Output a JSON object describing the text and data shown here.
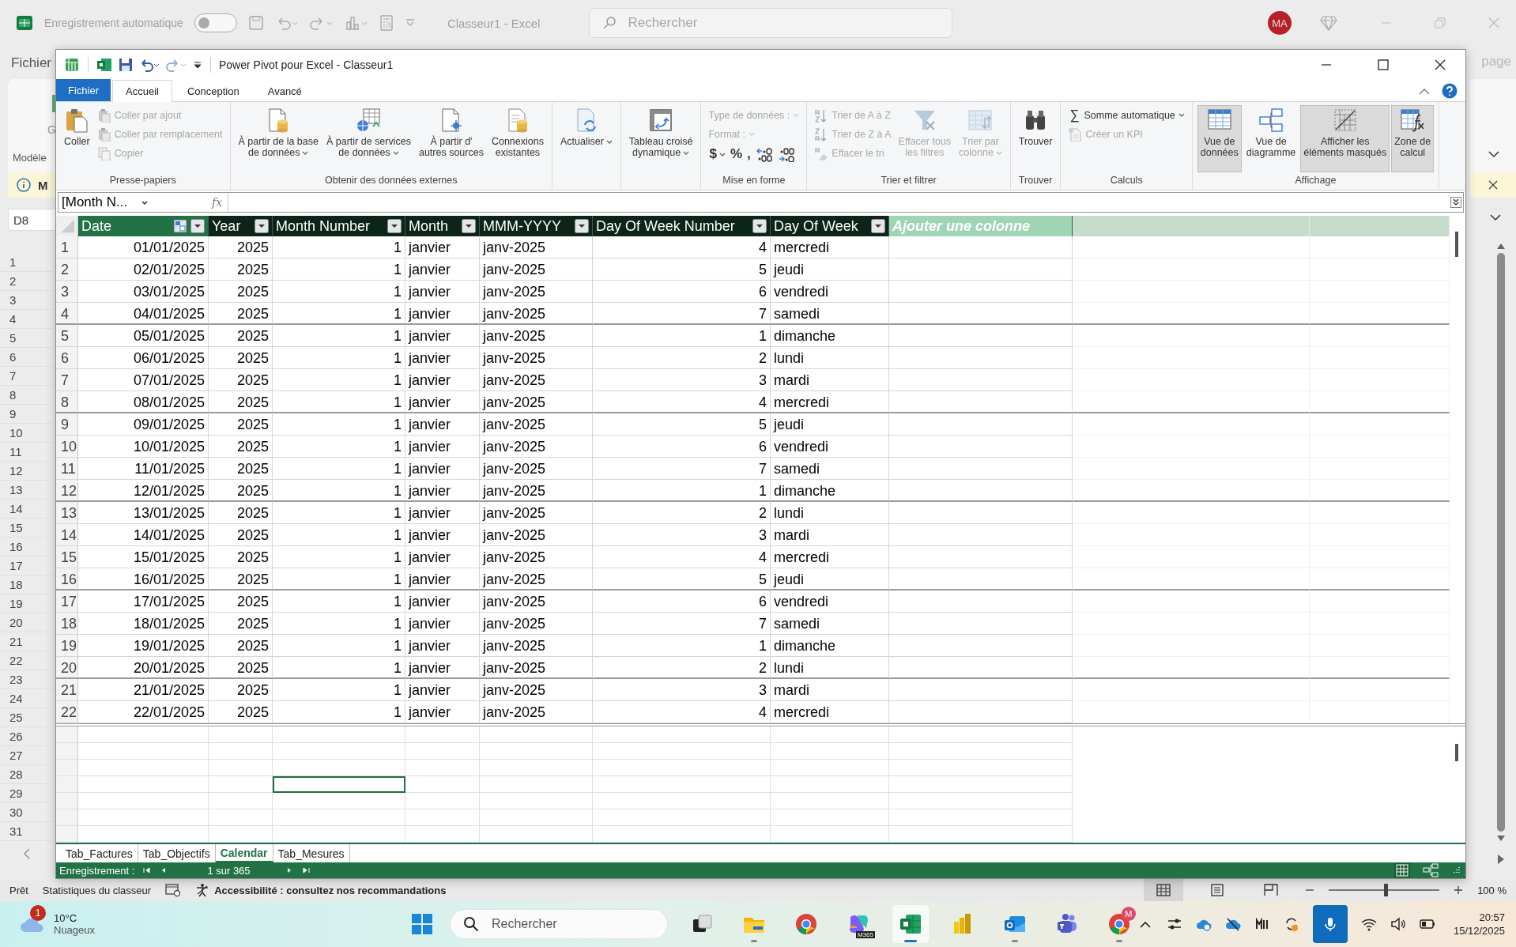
{
  "excel_window": {
    "autosave_label": "Enregistrement automatique",
    "autosave_on": false,
    "title": "Classeur1  -  Excel",
    "search_placeholder": "Rechercher",
    "avatar": "MA",
    "file_tab": "Fichier",
    "ribbon_fragment": "G",
    "group_fragment": "Modèle",
    "message_fragment": "M",
    "name_box": "D8",
    "right_tab_fragment": "page",
    "row_headers": [
      "1",
      "2",
      "3",
      "4",
      "5",
      "6",
      "7",
      "8",
      "9",
      "10",
      "11",
      "12",
      "13",
      "14",
      "15",
      "16",
      "17",
      "18",
      "19",
      "20",
      "21",
      "22",
      "23",
      "24",
      "25",
      "26",
      "27",
      "28",
      "29",
      "30",
      "31"
    ],
    "status_bar": {
      "ready": "Prêt",
      "stats": "Statistiques du classeur",
      "accessibility": "Accessibilité : consultez nos recommandations",
      "views": [
        {
          "selected": true
        },
        {
          "selected": false
        },
        {
          "selected": false
        }
      ],
      "zoom_slider": {
        "level": 0.52
      },
      "zoom": "100 %"
    }
  },
  "power_pivot": {
    "title": "Power Pivot pour Excel - Classeur1",
    "tabs": [
      {
        "label": "Fichier",
        "kind": "file",
        "selected": false
      },
      {
        "label": "Accueil",
        "kind": "tab",
        "selected": true
      },
      {
        "label": "Conception",
        "kind": "tab",
        "selected": false
      },
      {
        "label": "Avancé",
        "kind": "tab",
        "selected": false
      }
    ],
    "ribbon": [
      {
        "label": "Presse-papiers",
        "items": [
          {
            "kind": "large",
            "lines": [
              "Coller"
            ],
            "disabled": false
          },
          {
            "kind": "small",
            "label": "Coller par ajout",
            "disabled": true
          },
          {
            "kind": "small",
            "label": "Coller par remplacement",
            "disabled": true
          },
          {
            "kind": "small",
            "label": "Copier",
            "disabled": true
          }
        ]
      },
      {
        "label": "Obtenir des données externes",
        "items": [
          {
            "kind": "large",
            "lines": [
              "À partir de la base",
              "de données"
            ],
            "dropdown": true,
            "disabled": false
          },
          {
            "kind": "large",
            "lines": [
              "À partir de services",
              "de données"
            ],
            "dropdown": true,
            "disabled": false
          },
          {
            "kind": "large",
            "lines": [
              "À partir d'",
              "autres sources"
            ],
            "disabled": false
          },
          {
            "kind": "large",
            "lines": [
              "Connexions",
              "existantes"
            ],
            "disabled": false
          }
        ]
      },
      {
        "items": [
          {
            "kind": "large",
            "lines": [
              "Actualiser"
            ],
            "dropdown": true,
            "disabled": false
          }
        ]
      },
      {
        "items": [
          {
            "kind": "large",
            "lines": [
              "Tableau croisé",
              "dynamique"
            ],
            "dropdown": true,
            "disabled": false
          }
        ]
      },
      {
        "label": "Mise en forme",
        "items": [
          {
            "kind": "field",
            "label": "Type de données :",
            "disabled": true
          },
          {
            "kind": "field",
            "label": "Format :",
            "disabled": true
          },
          {
            "kind": "format",
            "buttons": [
              {
                "kind": "symbol",
                "symbol": "$",
                "dropdown": true
              },
              {
                "kind": "symbol",
                "symbol": "%"
              },
              {
                "kind": "symbol",
                "symbol": ","
              },
              {
                "kind": "more_decimals"
              },
              {
                "kind": "fewer_decimals"
              }
            ]
          }
        ]
      },
      {
        "label": "Trier et filtrer",
        "items": [
          {
            "kind": "small",
            "label": "Trier de A à Z",
            "disabled": true
          },
          {
            "kind": "small",
            "label": "Trier de Z à A",
            "disabled": true
          },
          {
            "kind": "small",
            "label": "Effacer le tri",
            "disabled": true
          },
          {
            "kind": "large",
            "lines": [
              "Effacer tous",
              "les filtres"
            ],
            "disabled": true
          },
          {
            "kind": "large",
            "lines": [
              "Trier par",
              "colonne"
            ],
            "dropdown": true,
            "disabled": true
          }
        ]
      },
      {
        "label": "Trouver",
        "items": [
          {
            "kind": "large",
            "lines": [
              "Trouver"
            ],
            "disabled": false
          }
        ]
      },
      {
        "label": "Calculs",
        "items": [
          {
            "kind": "small",
            "label": "Somme automatique",
            "symbol": "∑",
            "dropdown": true,
            "disabled": false
          },
          {
            "kind": "small",
            "label": "Créer un KPI",
            "disabled": true
          }
        ]
      },
      {
        "label": "Affichage",
        "items": [
          {
            "kind": "large",
            "lines": [
              "Vue de",
              "données"
            ],
            "selected": true
          },
          {
            "kind": "large",
            "lines": [
              "Vue de",
              "diagramme"
            ],
            "selected": false
          },
          {
            "kind": "large",
            "lines": [
              "Afficher les",
              "éléments masqués"
            ],
            "selected": true
          },
          {
            "kind": "large",
            "lines": [
              "Zone de",
              "calcul"
            ],
            "selected": true
          }
        ]
      }
    ],
    "formula_bar": {
      "name": "[Month N...",
      "function_symbol": "fx"
    },
    "table": {
      "columns": [
        {
          "label": "Date",
          "kind": "date_key"
        },
        {
          "label": "Year",
          "kind": "data"
        },
        {
          "label": "Month Number",
          "kind": "data"
        },
        {
          "label": "Month",
          "kind": "data"
        },
        {
          "label": "MMM-YYYY",
          "kind": "data"
        },
        {
          "label": "Day Of Week Number",
          "kind": "data"
        },
        {
          "label": "Day Of Week",
          "kind": "data"
        },
        {
          "label": "Ajouter une colonne",
          "kind": "add"
        }
      ],
      "rows": [
        {
          "number": "1",
          "cells": [
            "01/01/2025",
            "2025",
            "1",
            "janvier",
            "janv-2025",
            "4",
            "mercredi"
          ]
        },
        {
          "number": "2",
          "cells": [
            "02/01/2025",
            "2025",
            "1",
            "janvier",
            "janv-2025",
            "5",
            "jeudi"
          ]
        },
        {
          "number": "3",
          "cells": [
            "03/01/2025",
            "2025",
            "1",
            "janvier",
            "janv-2025",
            "6",
            "vendredi"
          ]
        },
        {
          "number": "4",
          "cells": [
            "04/01/2025",
            "2025",
            "1",
            "janvier",
            "janv-2025",
            "7",
            "samedi"
          ]
        },
        {
          "number": "5",
          "cells": [
            "05/01/2025",
            "2025",
            "1",
            "janvier",
            "janv-2025",
            "1",
            "dimanche"
          ]
        },
        {
          "number": "6",
          "cells": [
            "06/01/2025",
            "2025",
            "1",
            "janvier",
            "janv-2025",
            "2",
            "lundi"
          ]
        },
        {
          "number": "7",
          "cells": [
            "07/01/2025",
            "2025",
            "1",
            "janvier",
            "janv-2025",
            "3",
            "mardi"
          ]
        },
        {
          "number": "8",
          "cells": [
            "08/01/2025",
            "2025",
            "1",
            "janvier",
            "janv-2025",
            "4",
            "mercredi"
          ]
        },
        {
          "number": "9",
          "cells": [
            "09/01/2025",
            "2025",
            "1",
            "janvier",
            "janv-2025",
            "5",
            "jeudi"
          ]
        },
        {
          "number": "10",
          "cells": [
            "10/01/2025",
            "2025",
            "1",
            "janvier",
            "janv-2025",
            "6",
            "vendredi"
          ]
        },
        {
          "number": "11",
          "cells": [
            "11/01/2025",
            "2025",
            "1",
            "janvier",
            "janv-2025",
            "7",
            "samedi"
          ]
        },
        {
          "number": "12",
          "cells": [
            "12/01/2025",
            "2025",
            "1",
            "janvier",
            "janv-2025",
            "1",
            "dimanche"
          ]
        },
        {
          "number": "13",
          "cells": [
            "13/01/2025",
            "2025",
            "1",
            "janvier",
            "janv-2025",
            "2",
            "lundi"
          ]
        },
        {
          "number": "14",
          "cells": [
            "14/01/2025",
            "2025",
            "1",
            "janvier",
            "janv-2025",
            "3",
            "mardi"
          ]
        },
        {
          "number": "15",
          "cells": [
            "15/01/2025",
            "2025",
            "1",
            "janvier",
            "janv-2025",
            "4",
            "mercredi"
          ]
        },
        {
          "number": "16",
          "cells": [
            "16/01/2025",
            "2025",
            "1",
            "janvier",
            "janv-2025",
            "5",
            "jeudi"
          ]
        },
        {
          "number": "17",
          "cells": [
            "17/01/2025",
            "2025",
            "1",
            "janvier",
            "janv-2025",
            "6",
            "vendredi"
          ]
        },
        {
          "number": "18",
          "cells": [
            "18/01/2025",
            "2025",
            "1",
            "janvier",
            "janv-2025",
            "7",
            "samedi"
          ]
        },
        {
          "number": "19",
          "cells": [
            "19/01/2025",
            "2025",
            "1",
            "janvier",
            "janv-2025",
            "1",
            "dimanche"
          ]
        },
        {
          "number": "20",
          "cells": [
            "20/01/2025",
            "2025",
            "1",
            "janvier",
            "janv-2025",
            "2",
            "lundi"
          ]
        },
        {
          "number": "21",
          "cells": [
            "21/01/2025",
            "2025",
            "1",
            "janvier",
            "janv-2025",
            "3",
            "mardi"
          ]
        },
        {
          "number": "22",
          "cells": [
            "22/01/2025",
            "2025",
            "1",
            "janvier",
            "janv-2025",
            "4",
            "mercredi"
          ]
        }
      ]
    },
    "calc_area": {
      "rows": [
        [
          {
            "selected": false
          },
          {
            "selected": false
          },
          {
            "selected": false
          },
          {
            "selected": false
          },
          {
            "selected": false
          },
          {
            "selected": false
          },
          {
            "selected": false
          },
          {
            "selected": false
          }
        ],
        [
          {
            "selected": false
          },
          {
            "selected": false
          },
          {
            "selected": false
          },
          {
            "selected": false
          },
          {
            "selected": false
          },
          {
            "selected": false
          },
          {
            "selected": false
          },
          {
            "selected": false
          }
        ],
        [
          {
            "selected": false
          },
          {
            "selected": false
          },
          {
            "selected": false
          },
          {
            "selected": false
          },
          {
            "selected": false
          },
          {
            "selected": false
          },
          {
            "selected": false
          },
          {
            "selected": false
          }
        ],
        [
          {
            "selected": false
          },
          {
            "selected": false
          },
          {
            "selected": true
          },
          {
            "selected": false
          },
          {
            "selected": false
          },
          {
            "selected": false
          },
          {
            "selected": false
          },
          {
            "selected": false
          }
        ],
        [
          {
            "selected": false
          },
          {
            "selected": false
          },
          {
            "selected": false
          },
          {
            "selected": false
          },
          {
            "selected": false
          },
          {
            "selected": false
          },
          {
            "selected": false
          },
          {
            "selected": false
          }
        ],
        [
          {
            "selected": false
          },
          {
            "selected": false
          },
          {
            "selected": false
          },
          {
            "selected": false
          },
          {
            "selected": false
          },
          {
            "selected": false
          },
          {
            "selected": false
          },
          {
            "selected": false
          }
        ],
        [
          {
            "selected": false
          },
          {
            "selected": false
          },
          {
            "selected": false
          },
          {
            "selected": false
          },
          {
            "selected": false
          },
          {
            "selected": false
          },
          {
            "selected": false
          },
          {
            "selected": false
          }
        ]
      ]
    },
    "sheet_tabs": [
      {
        "label": "Tab_Factures",
        "selected": false
      },
      {
        "label": "Tab_Objectifs",
        "selected": false
      },
      {
        "label": "Calendar",
        "selected": true
      },
      {
        "label": "Tab_Mesures",
        "selected": false
      }
    ],
    "record_bar": {
      "label": "Enregistrement :",
      "position": "1 sur 365"
    }
  },
  "taskbar": {
    "weather": {
      "badge": "1",
      "temperature": "10°C",
      "condition": "Nuageux"
    },
    "search_placeholder": "Rechercher",
    "apps": [
      {
        "kind": "task_view",
        "selected": false,
        "running": false
      },
      {
        "kind": "explorer",
        "selected": false,
        "running": true
      },
      {
        "kind": "chrome",
        "selected": false,
        "running": false
      },
      {
        "kind": "copilot",
        "label": "M365",
        "selected": false,
        "running": false
      },
      {
        "kind": "excel",
        "selected": true,
        "running": true
      },
      {
        "kind": "powerbi",
        "selected": false,
        "running": false
      },
      {
        "kind": "outlook",
        "selected": false,
        "running": true
      },
      {
        "kind": "teams",
        "selected": false,
        "running": false
      },
      {
        "kind": "chrome",
        "badge": "M",
        "selected": false,
        "running": true
      }
    ],
    "tray": [
      {
        "kind": "chevron",
        "active": false
      },
      {
        "kind": "sliders",
        "active": false
      },
      {
        "kind": "cloud_sync",
        "active": false
      },
      {
        "kind": "cloud_off",
        "active": false
      },
      {
        "kind": "bars",
        "active": false
      },
      {
        "kind": "sync",
        "active": false
      },
      {
        "kind": "mic",
        "active": true
      },
      {
        "kind": "wifi",
        "active": false
      },
      {
        "kind": "volume",
        "active": false
      },
      {
        "kind": "battery",
        "active": false
      }
    ],
    "clock": {
      "time": "20:57",
      "date": "15/12/2025"
    }
  }
}
